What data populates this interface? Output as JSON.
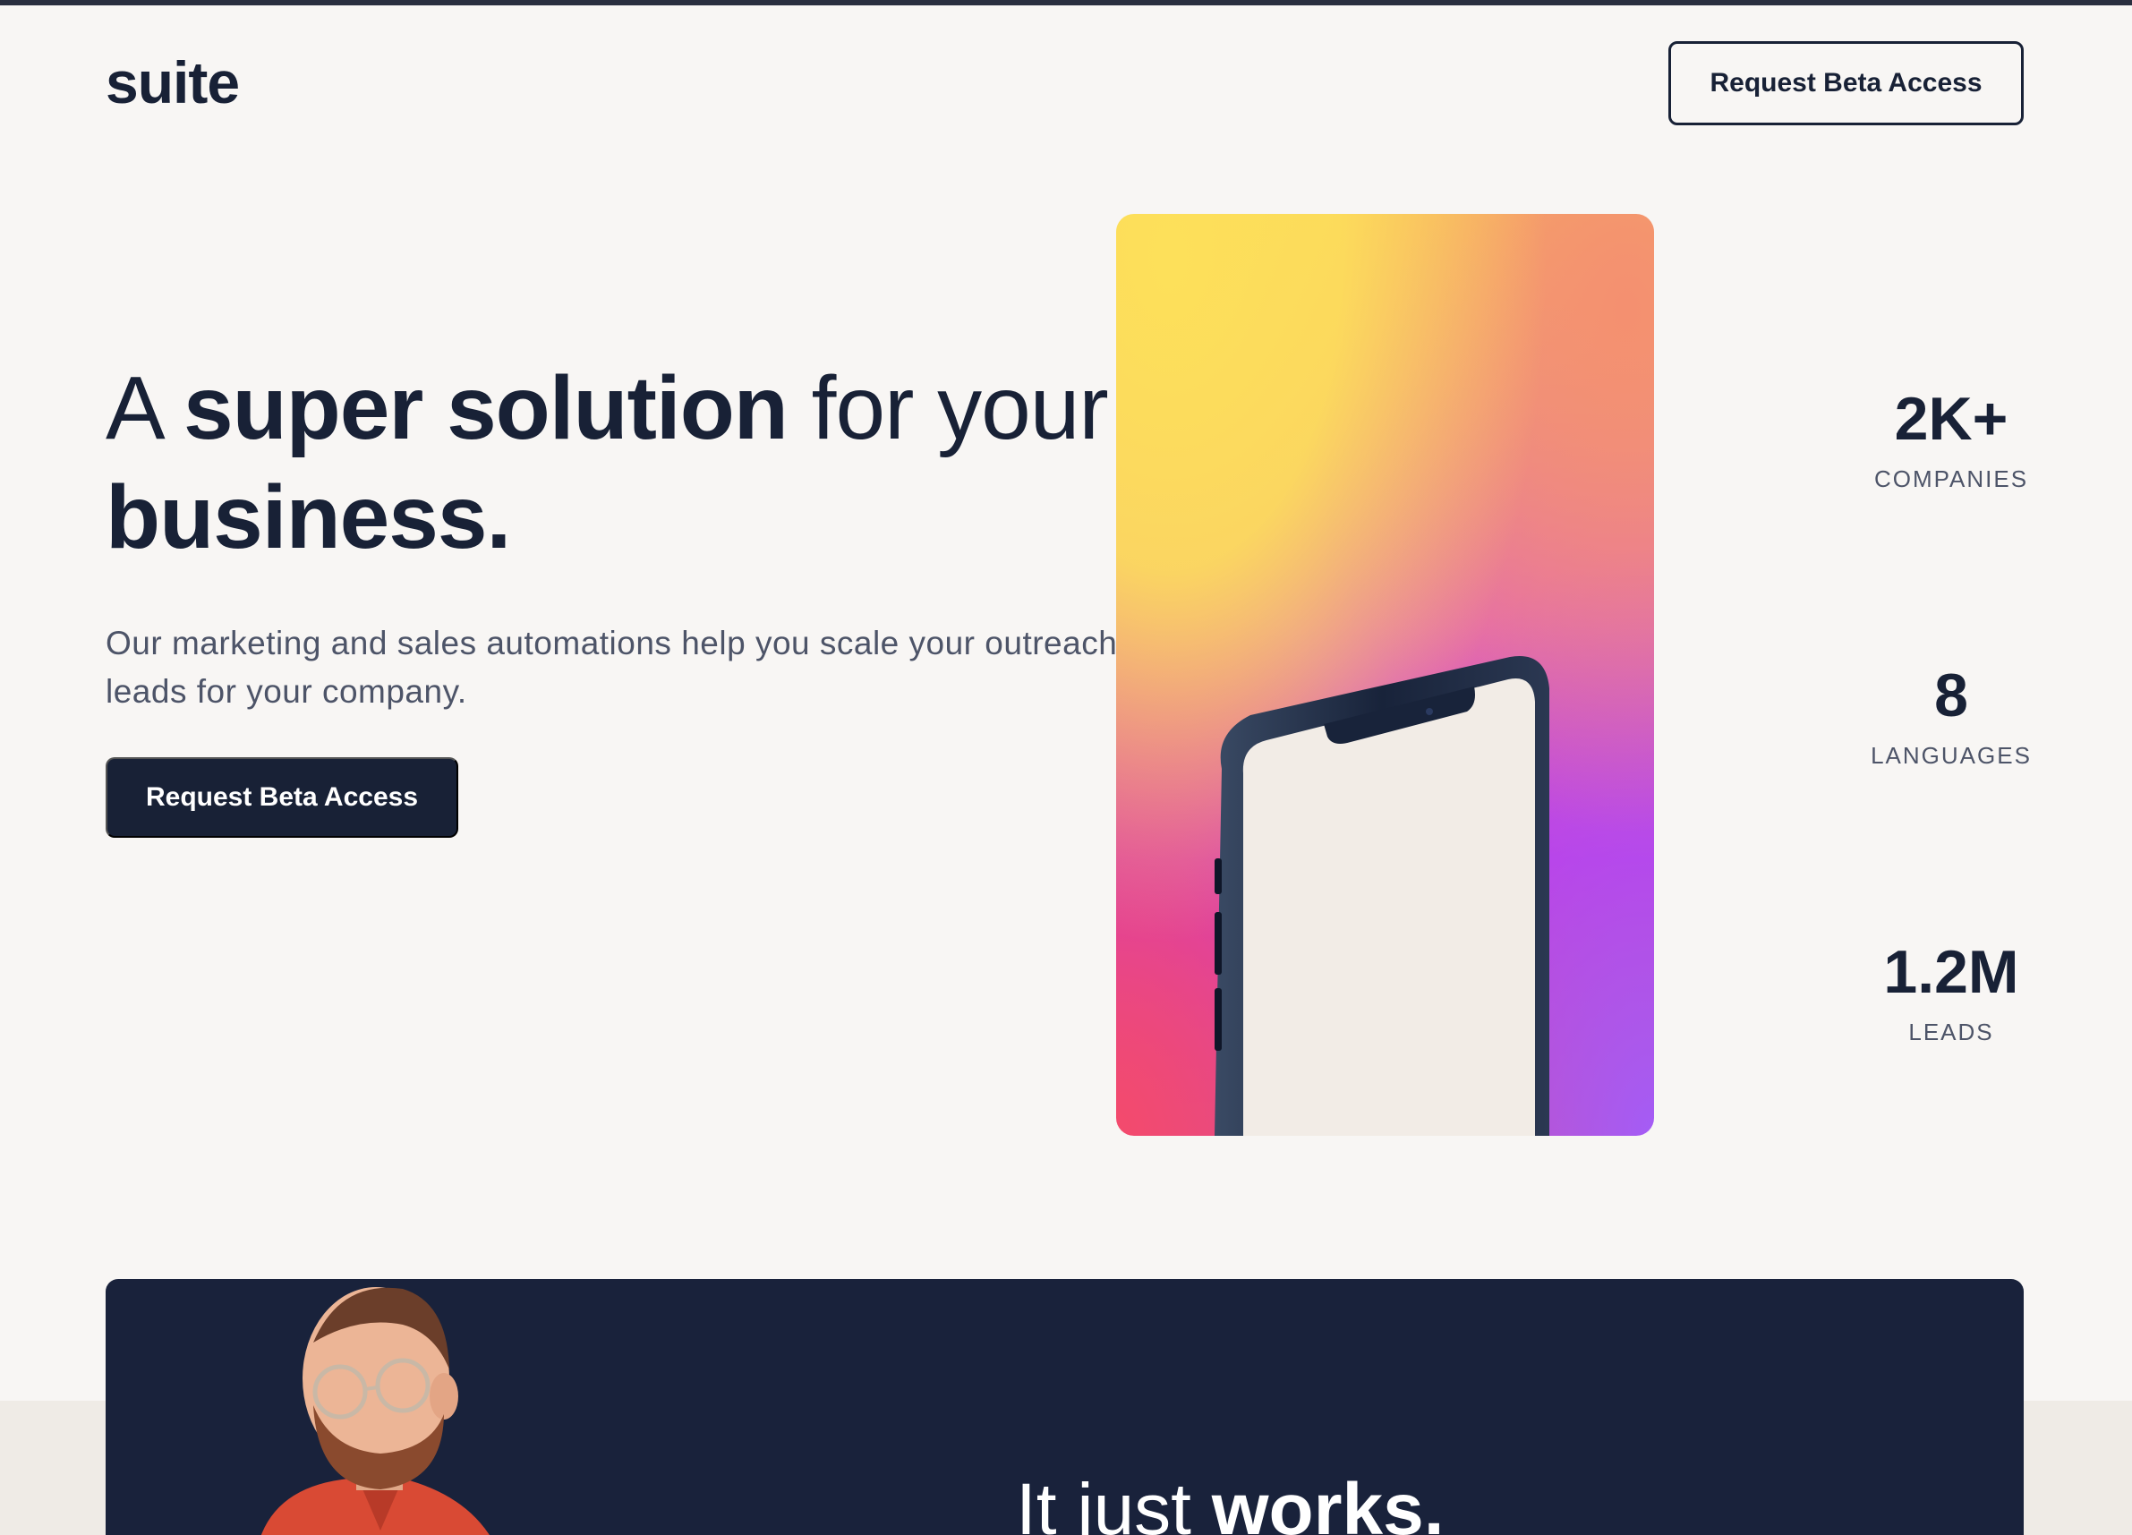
{
  "header": {
    "logo": "suite",
    "cta_label": "Request Beta Access"
  },
  "hero": {
    "title_part1": "A ",
    "title_bold1": "super solution",
    "title_part2": " for your ",
    "title_bold2": "business.",
    "subtitle": "Our marketing and sales automations help you scale your outreach to get more leads for your company.",
    "cta_label": "Request Beta Access"
  },
  "stats": [
    {
      "value": "2K+",
      "label": "COMPANIES"
    },
    {
      "value": "8",
      "label": "LANGUAGES"
    },
    {
      "value": "1.2M",
      "label": "LEADS"
    }
  ],
  "feature": {
    "heading_light": "It just ",
    "heading_bold": "works."
  },
  "colors": {
    "navy": "#182136",
    "background": "#f8f6f4",
    "card_dark": "#19223b",
    "accent_pink": "#f0609c"
  },
  "icons": {
    "phone_illustration": "phone-chart-icon",
    "portrait": "person-photo"
  }
}
